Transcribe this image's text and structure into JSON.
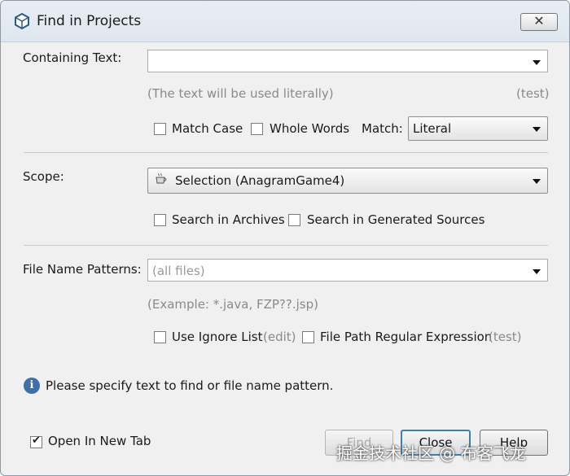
{
  "window": {
    "title": "Find in Projects",
    "close_glyph": "✕",
    "title_icon": "netbeans-cube-icon"
  },
  "containing_text": {
    "label": "Containing Text:",
    "value": "",
    "hint_left": "(The text will be used literally)",
    "hint_right": "(test)",
    "match_case_label": "Match Case",
    "match_case_checked": false,
    "whole_words_label": "Whole Words",
    "whole_words_checked": false,
    "match_label": "Match:",
    "match_value": "Literal"
  },
  "scope": {
    "label": "Scope:",
    "value": "Selection (AnagramGame4)",
    "value_icon": "java-project-icon",
    "search_archives_label": "Search in Archives",
    "search_archives_checked": false,
    "search_generated_label": "Search in Generated Sources",
    "search_generated_checked": false
  },
  "file_name_patterns": {
    "label": "File Name Patterns:",
    "placeholder": "(all files)",
    "example": "(Example: *.java, FZP??.jsp)",
    "use_ignore_list_label": "Use Ignore List",
    "use_ignore_list_checked": false,
    "edit_link": "(edit)",
    "regex_label": "File Path Regular Expression",
    "regex_checked": false,
    "test_link": "(test)"
  },
  "info": {
    "icon": "info-icon",
    "message": "Please specify text to find or file name pattern."
  },
  "footer": {
    "open_in_new_tab_label": "Open In New Tab",
    "open_in_new_tab_checked": true,
    "find_label": "Find",
    "close_label": "Close",
    "help_label": "Help"
  },
  "watermark": "掘金技术社区 @ 布客飞龙"
}
